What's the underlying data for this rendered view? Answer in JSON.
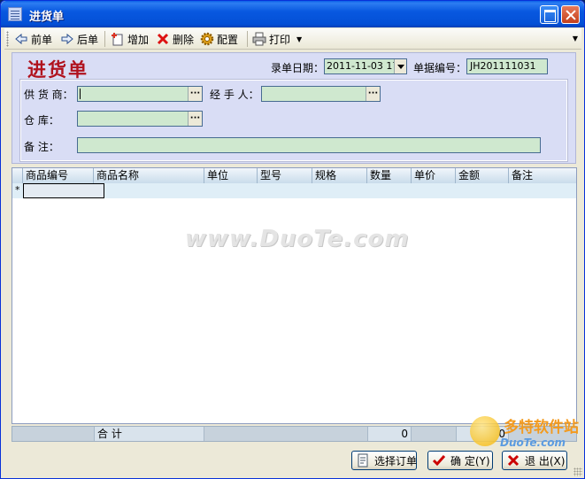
{
  "window": {
    "title": "进货单",
    "accent": "#0858e0"
  },
  "toolbar": {
    "prev_label": "前单",
    "next_label": "后单",
    "add_label": "增加",
    "delete_label": "删除",
    "config_label": "配置",
    "print_label": "打印"
  },
  "form": {
    "heading": "进货单",
    "date_label": "录单日期：",
    "date_value": "2011-11-03 17",
    "doc_no_label": "单据编号：",
    "doc_no_value": "JH201111031",
    "supplier_label": "供 货 商：",
    "supplier_value": "",
    "handler_label": "经 手 人：",
    "handler_value": "",
    "warehouse_label": "仓    库：",
    "warehouse_value": "",
    "remark_label": "备    注：",
    "remark_value": "",
    "ellipsis": "···"
  },
  "grid": {
    "columns": [
      "商品编号",
      "商品名称",
      "单位",
      "型号",
      "规格",
      "数量",
      "单价",
      "金额",
      "备注"
    ],
    "new_row_marker": "*"
  },
  "totals": {
    "label": "合  计",
    "quantity_total": "0",
    "amount_total": "0"
  },
  "buttons": {
    "select_order": "选择订单",
    "ok": "确  定(Y)",
    "exit": "退  出(X)"
  },
  "watermark": "www.DuoTe.com",
  "corner_logo": {
    "main": "多特软件站",
    "sub": "DuoTe.com"
  }
}
